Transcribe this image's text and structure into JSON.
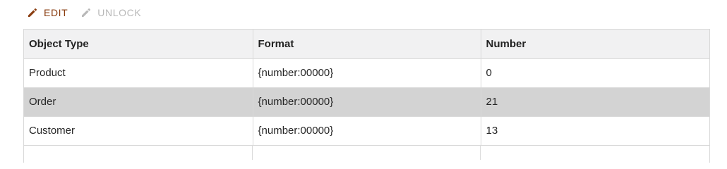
{
  "toolbar": {
    "edit_label": "EDIT",
    "unlock_label": "UNLOCK",
    "edit_icon": "pencil-icon",
    "unlock_icon": "pencil-icon",
    "edit_color": "#8a3d10",
    "unlock_color": "#b8b8b8"
  },
  "table": {
    "columns": [
      "Object Type",
      "Format",
      "Number"
    ],
    "rows": [
      [
        "Product",
        "{number:00000}",
        "0"
      ],
      [
        "Order",
        "{number:00000}",
        "21"
      ],
      [
        "Customer",
        "{number:00000}",
        "13"
      ]
    ],
    "selected_row": 1,
    "selected_color": "#d3d3d3",
    "header_color": "#f1f1f2"
  }
}
